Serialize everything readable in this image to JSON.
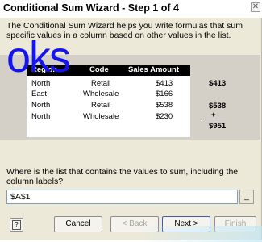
{
  "window": {
    "title": "Conditional Sum Wizard - Step 1 of 4",
    "close_symbol": "✕"
  },
  "intro": "The Conditional Sum Wizard helps you write formulas that sum specific values in a column based on other values in the list.",
  "preview": {
    "headers": [
      "Region",
      "Code",
      "Sales Amount"
    ],
    "rows": [
      {
        "region": "North",
        "code": "Retail",
        "amount": "$413"
      },
      {
        "region": "East",
        "code": "Wholesale",
        "amount": "$166"
      },
      {
        "region": "North",
        "code": "Retail",
        "amount": "$538"
      },
      {
        "region": "North",
        "code": "Wholesale",
        "amount": "$230"
      }
    ],
    "results": [
      "$413",
      "$538"
    ],
    "plus": "+",
    "total": "$951"
  },
  "overlay_text": "oks",
  "question": "Where is the list that contains the values to sum, including the column labels?",
  "range_input": {
    "value": "$A$1"
  },
  "buttons": {
    "help": "?",
    "cancel": "Cancel",
    "back": "< Back",
    "next": "Next >",
    "finish": "Finish",
    "collapse": "_"
  },
  "colors": {
    "overlay": "#1414f0",
    "preview_bg": "#d4d0c8",
    "dialog_bg": "#ece9d8"
  }
}
